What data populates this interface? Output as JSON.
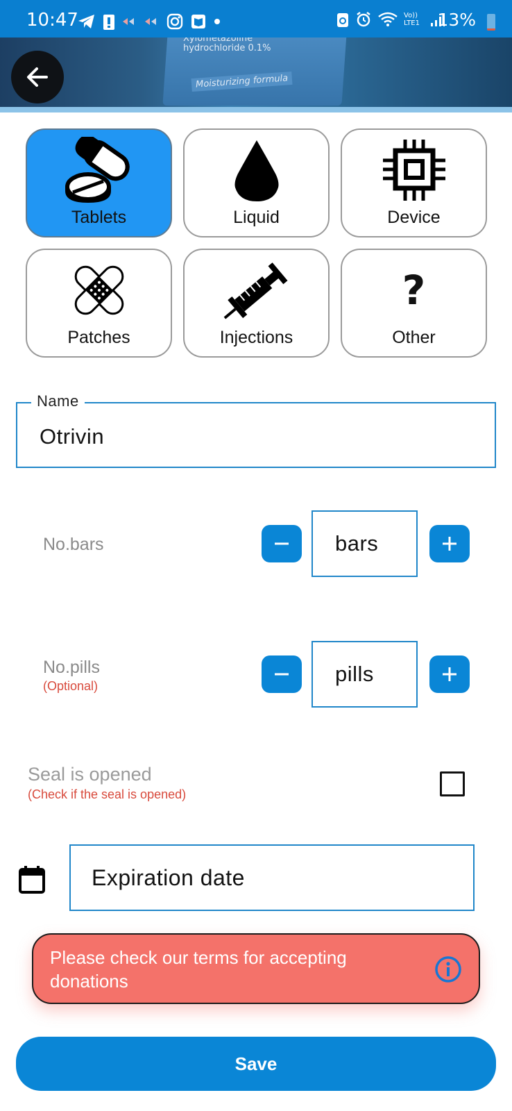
{
  "status_bar": {
    "time": "10:47",
    "battery": "13%",
    "battery_level": 0.13,
    "network": "Vo)) LTE1"
  },
  "header": {
    "photo_text_line1": "Xylometazoline",
    "photo_text_line2": "hydrochloride 0.1%",
    "photo_text_line3": "Moisturizing formula"
  },
  "categories": [
    {
      "label": "Tablets",
      "icon": "pills-icon",
      "selected": true
    },
    {
      "label": "Liquid",
      "icon": "drop-icon",
      "selected": false
    },
    {
      "label": "Device",
      "icon": "chip-icon",
      "selected": false
    },
    {
      "label": "Patches",
      "icon": "bandage-icon",
      "selected": false
    },
    {
      "label": "Injections",
      "icon": "syringe-icon",
      "selected": false
    },
    {
      "label": "Other",
      "icon": "question-icon",
      "selected": false
    }
  ],
  "other_symbol": "?",
  "name_field": {
    "label": "Name",
    "value": "Otrivin"
  },
  "bars_row": {
    "label": "No.bars",
    "value": "bars",
    "minus": "−",
    "plus": "+"
  },
  "pills_row": {
    "label": "No.pills",
    "sublabel": "(Optional)",
    "value": "pills",
    "minus": "−",
    "plus": "+"
  },
  "seal": {
    "label": "Seal is opened",
    "sublabel": "(Check if the seal is opened)",
    "checked": false
  },
  "expiration": {
    "placeholder": "Expiration date"
  },
  "terms_banner": {
    "text": "Please check our terms for accepting donations"
  },
  "save_button": {
    "label": "Save"
  },
  "colors": {
    "primary": "#0a86d6",
    "status_bar": "#0a7fd0",
    "selected_tile": "#2196f3",
    "alert": "#f4726a",
    "optional_red": "#d84a3c"
  }
}
